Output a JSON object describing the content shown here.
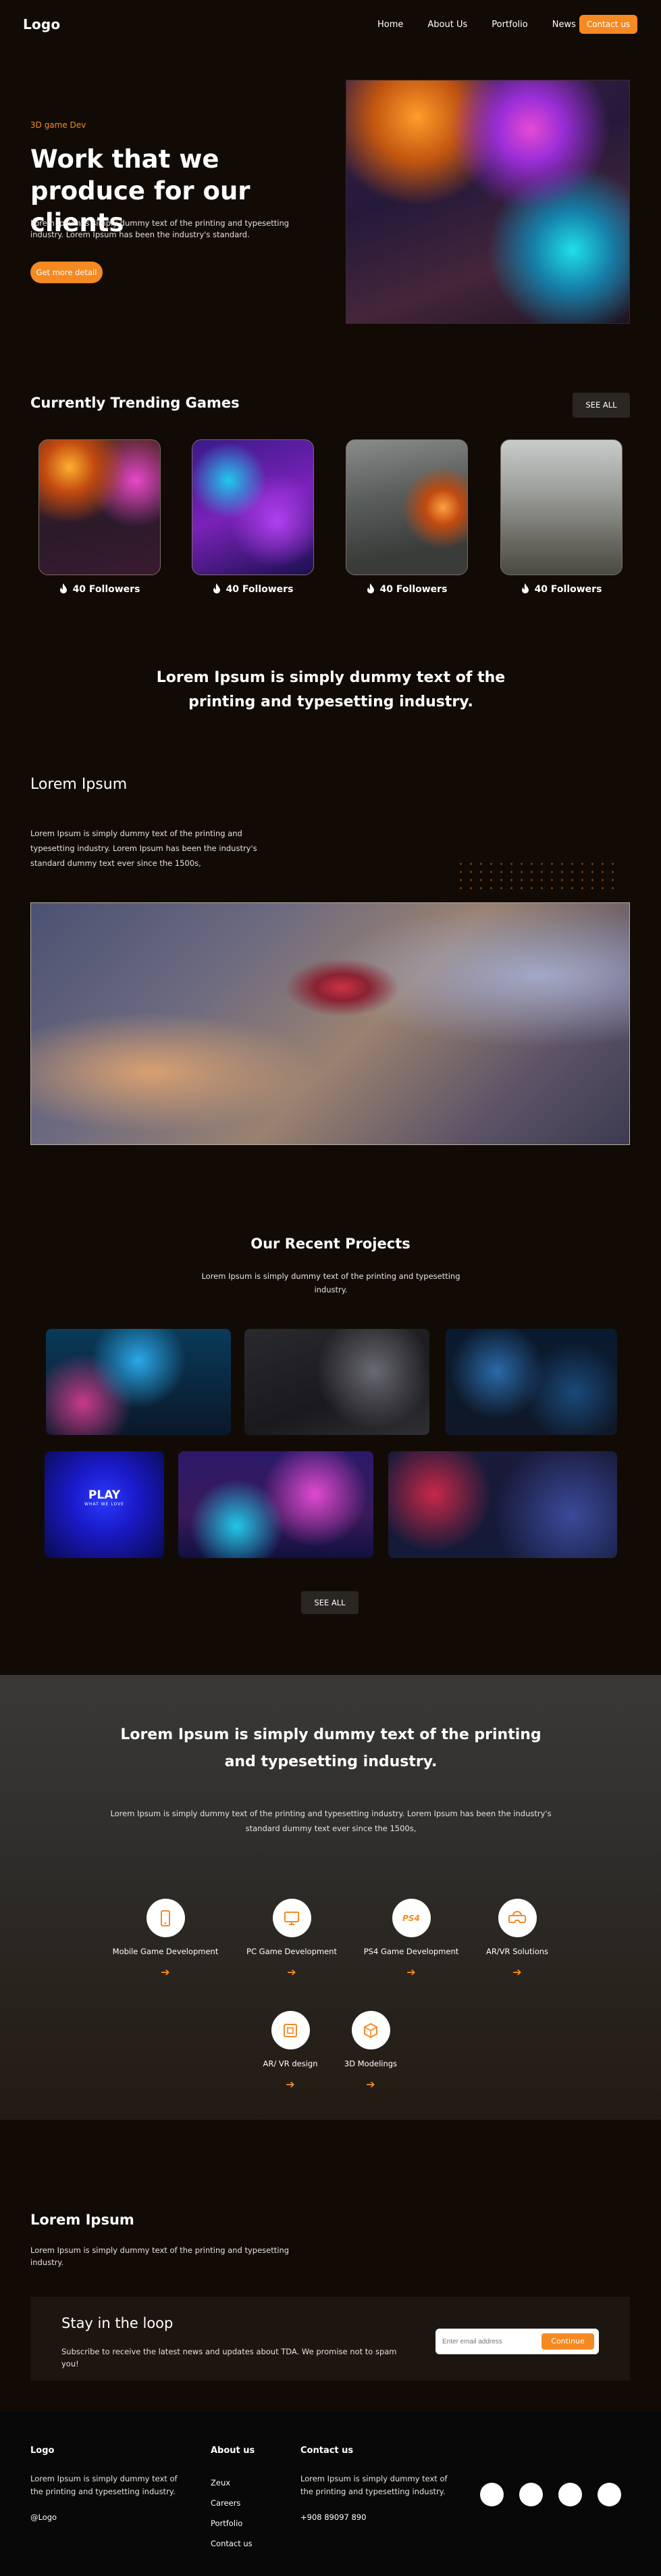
{
  "nav": {
    "logo": "Logo",
    "links": [
      "Home",
      "About Us",
      "Portfolio",
      "News"
    ],
    "cta": "Contact us"
  },
  "hero": {
    "eyebrow": "3D game Dev",
    "title": "Work that we produce for our clients",
    "description": "Lorem Ipsum is simply dummy text of the printing and typesetting industry. Lorem Ipsum has been the industry's standard.",
    "button": "Get more detail"
  },
  "trending": {
    "title": "Currently Trending Games",
    "see_all": "SEE ALL",
    "cards": [
      {
        "followers": "40 Followers"
      },
      {
        "followers": "40 Followers"
      },
      {
        "followers": "40 Followers"
      },
      {
        "followers": "40 Followers"
      }
    ]
  },
  "statement": "Lorem Ipsum is simply dummy text of the printing and typesetting industry.",
  "lorem_section": {
    "title": "Lorem Ipsum",
    "description": "Lorem Ipsum is simply dummy text of the printing and typesetting industry. Lorem Ipsum has been the industry's standard dummy text ever since the 1500s,"
  },
  "projects": {
    "title": "Our Recent Projects",
    "description": "Lorem Ipsum is simply dummy text of the printing and typesetting industry.",
    "see_all": "SEE ALL",
    "play_title": "PLAY",
    "play_subtitle": "WHAT WE LOVE"
  },
  "services": {
    "title": "Lorem Ipsum is simply dummy text of the printing and typesetting industry.",
    "description": "Lorem Ipsum is simply dummy text of the printing and typesetting industry. Lorem Ipsum has been the industry's standard dummy text ever since the 1500s,",
    "items": [
      {
        "label": "Mobile Game Development",
        "icon": "mobile-icon"
      },
      {
        "label": "PC Game Development",
        "icon": "pc-icon"
      },
      {
        "label": "PS4 Game Development",
        "icon": "ps4-icon",
        "glyph": "PS4"
      },
      {
        "label": "AR/VR Solutions",
        "icon": "vr-headset-icon"
      },
      {
        "label": "AR/ VR design",
        "icon": "vr-design-icon"
      },
      {
        "label": "3D Modelings",
        "icon": "3d-model-icon"
      }
    ]
  },
  "lorem_section_2": {
    "title": "Lorem Ipsum",
    "description": "Lorem Ipsum is simply dummy text of the printing and typesetting industry."
  },
  "newsletter": {
    "title": "Stay in the loop",
    "description": "Subscribe to receive the latest news and updates about TDA. We promise not to spam you!",
    "placeholder": "Enter email address",
    "button": "Continue"
  },
  "footer": {
    "logo": "Logo",
    "description": "Lorem Ipsum is simply dummy text of the printing and typesetting industry.",
    "handle": "@Logo",
    "about_title": "About us",
    "about_links": [
      "Zeux",
      "Careers",
      "Portfolio",
      "Contact us"
    ],
    "contact_title": "Contact us",
    "contact_description": "Lorem Ipsum is simply dummy text of the printing and typesetting industry.",
    "phone": "+908 89097 890"
  },
  "colors": {
    "accent": "#f58a23",
    "background": "#120b05",
    "footer": "#080808"
  }
}
